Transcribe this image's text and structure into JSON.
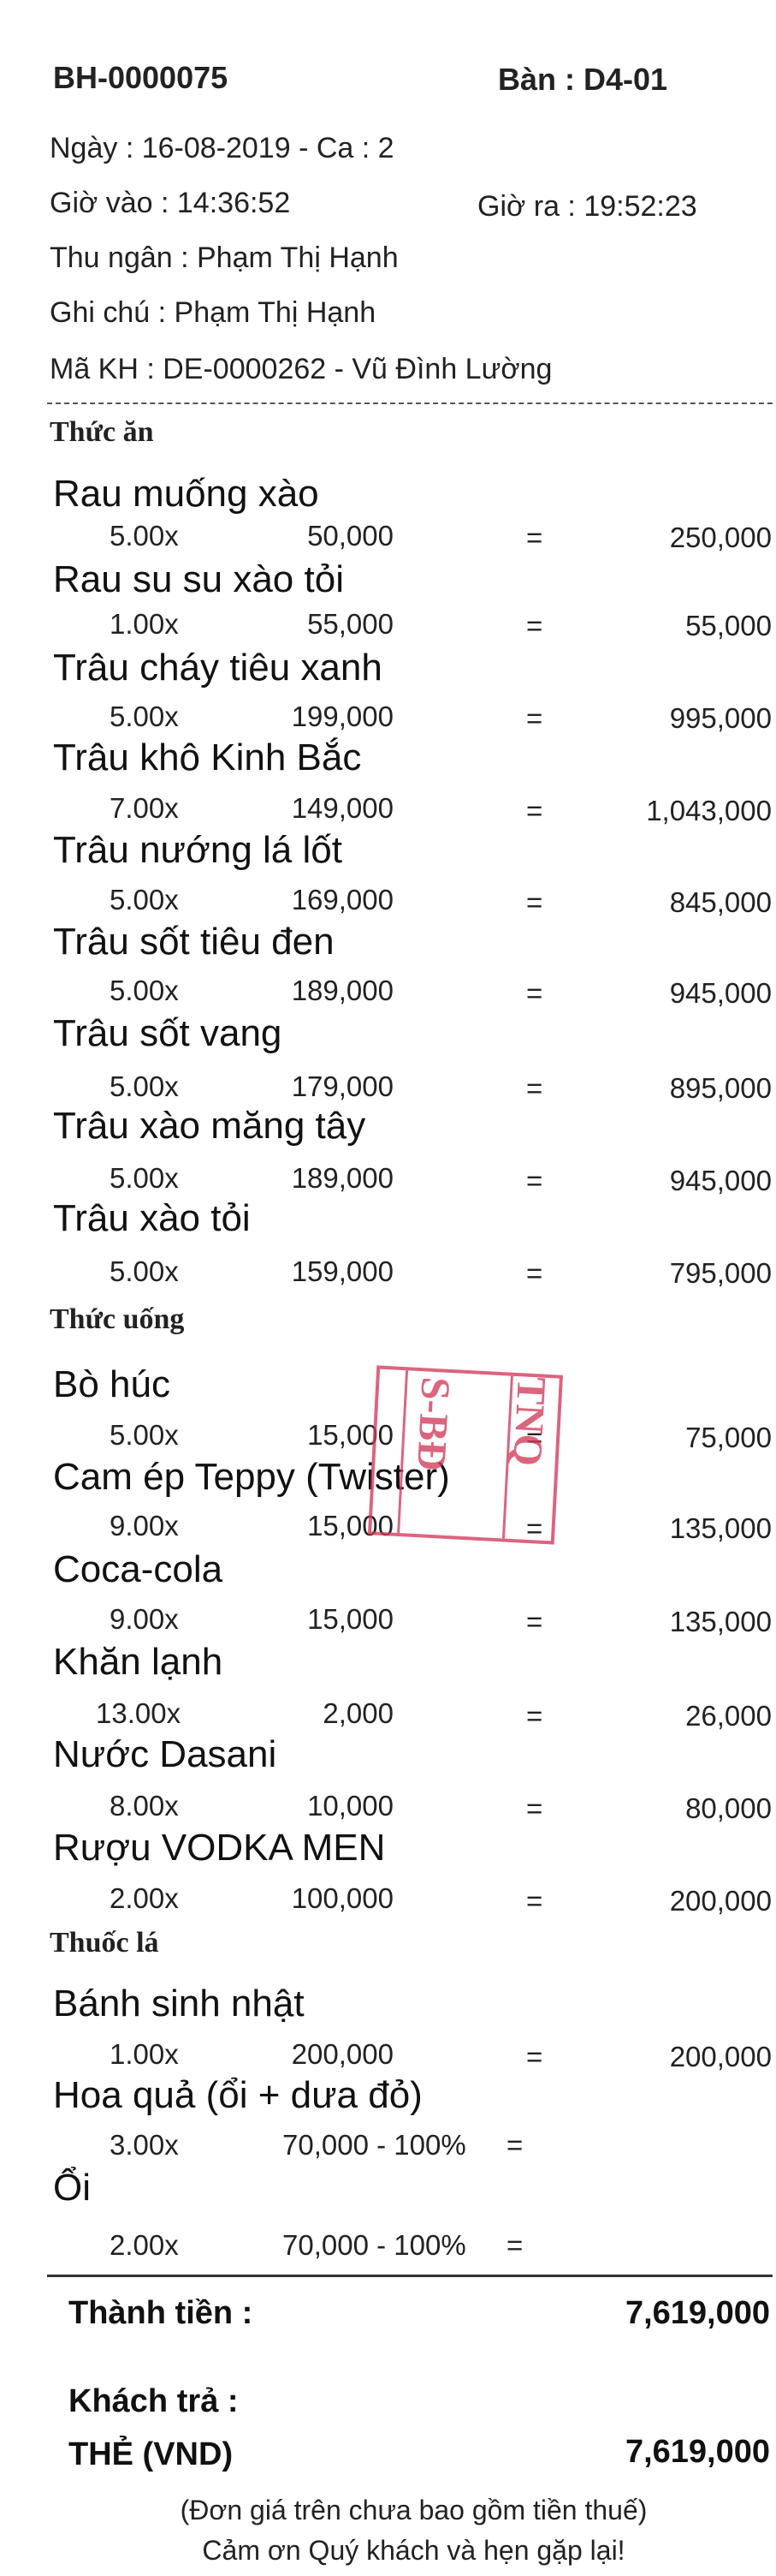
{
  "receipt": {
    "invoice_no": "BH-0000075",
    "table": "Bàn : D4-01",
    "date_line": "Ngày : 16-08-2019 - Ca : 2",
    "time_in": "Giờ vào : 14:36:52",
    "time_out": "Giờ ra : 19:52:23",
    "cashier": "Thu ngân : Phạm Thị Hạnh",
    "note": "Ghi chú : Phạm Thị Hạnh",
    "customer": "Mã KH : DE-0000262 - Vũ Đình Lường"
  },
  "sections": {
    "food": "Thức ăn",
    "drinks": "Thức uống",
    "tobacco": "Thuốc lá"
  },
  "items": [
    {
      "name": "Rau muống xào",
      "qty": "5.00x",
      "price": "50,000",
      "eq": "=",
      "total": "250,000"
    },
    {
      "name": "Rau su su xào tỏi",
      "qty": "1.00x",
      "price": "55,000",
      "eq": "=",
      "total": "55,000"
    },
    {
      "name": "Trâu cháy tiêu xanh",
      "qty": "5.00x",
      "price": "199,000",
      "eq": "=",
      "total": "995,000"
    },
    {
      "name": "Trâu khô Kinh Bắc",
      "qty": "7.00x",
      "price": "149,000",
      "eq": "=",
      "total": "1,043,000"
    },
    {
      "name": "Trâu nướng lá lốt",
      "qty": "5.00x",
      "price": "169,000",
      "eq": "=",
      "total": "845,000"
    },
    {
      "name": "Trâu sốt tiêu đen",
      "qty": "5.00x",
      "price": "189,000",
      "eq": "=",
      "total": "945,000"
    },
    {
      "name": "Trâu sốt vang",
      "qty": "5.00x",
      "price": "179,000",
      "eq": "=",
      "total": "895,000"
    },
    {
      "name": "Trâu xào măng tây",
      "qty": "5.00x",
      "price": "189,000",
      "eq": "=",
      "total": "945,000"
    },
    {
      "name": "Trâu xào tỏi",
      "qty": "5.00x",
      "price": "159,000",
      "eq": "=",
      "total": "795,000"
    },
    {
      "name": "Bò húc",
      "qty": "5.00x",
      "price": "15,000",
      "eq": "=",
      "total": "75,000"
    },
    {
      "name": "Cam ép Teppy (Twister)",
      "qty": "9.00x",
      "price": "15,000",
      "eq": "=",
      "total": "135,000"
    },
    {
      "name": "Coca-cola",
      "qty": "9.00x",
      "price": "15,000",
      "eq": "=",
      "total": "135,000"
    },
    {
      "name": "Khăn lạnh",
      "qty": "13.00x",
      "price": "2,000",
      "eq": "=",
      "total": "26,000"
    },
    {
      "name": "Nước Dasani",
      "qty": "8.00x",
      "price": "10,000",
      "eq": "=",
      "total": "80,000"
    },
    {
      "name": "Rượu VODKA MEN",
      "qty": "2.00x",
      "price": "100,000",
      "eq": "=",
      "total": "200,000"
    },
    {
      "name": "Bánh sinh nhật",
      "qty": "1.00x",
      "price": "200,000",
      "eq": "=",
      "total": "200,000"
    },
    {
      "name": "Hoa quả (ổi + dưa đỏ)",
      "qty": "3.00x",
      "price": "70,000 - 100%",
      "eq": "=",
      "total": ""
    },
    {
      "name": "Ổi",
      "qty": "2.00x",
      "price": "70,000 - 100%",
      "eq": "=",
      "total": ""
    }
  ],
  "totals": {
    "subtotal_label": "Thành tiền :",
    "subtotal_value": "7,619,000",
    "paid_label": "Khách trả :",
    "method_label": "THẺ (VND)",
    "paid_value": "7,619,000"
  },
  "footer": {
    "line1": "(Đơn giá trên chưa bao gồm tiền thuế)",
    "line2": "Cảm ơn Quý khách và hẹn gặp lại!"
  },
  "stamp": {
    "text_a": "TNQ",
    "text_b": "S-BĐ",
    "color": "#d23a5a"
  }
}
